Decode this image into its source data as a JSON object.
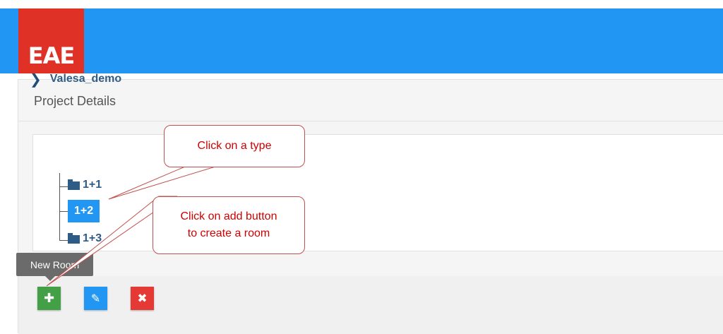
{
  "header": {
    "logo_text": "EAE",
    "bar_color": "#2196f3",
    "logo_color": "#e03127"
  },
  "panel": {
    "title": "Project Details"
  },
  "tree": {
    "root_label": "Valesa_demo",
    "nodes": [
      {
        "label": "1+1",
        "icon": "folder-icon",
        "selected": false
      },
      {
        "label": "1+2",
        "icon": "folder-icon",
        "selected": true
      },
      {
        "label": "1+3",
        "icon": "folder-icon",
        "selected": false
      }
    ]
  },
  "toolbar": {
    "tooltip": "New Room",
    "add_icon": "plus-icon",
    "edit_icon": "pencil-icon",
    "delete_icon": "close-icon",
    "colors": {
      "add": "#43a047",
      "edit": "#2196f3",
      "delete": "#e53935"
    }
  },
  "annotations": {
    "callout_1": "Click on a type",
    "callout_2_line1": "Click on add button",
    "callout_2_line2": "to create a room"
  }
}
